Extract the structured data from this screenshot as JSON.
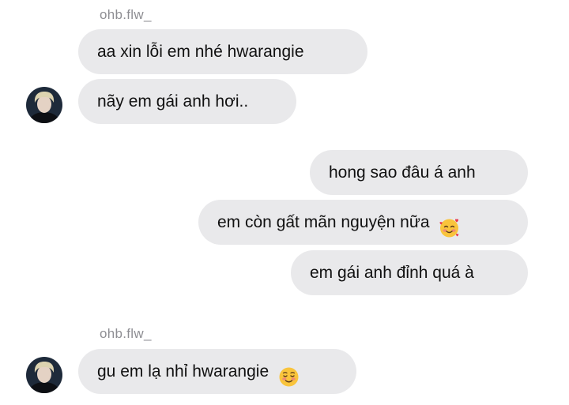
{
  "thread": {
    "group1": {
      "sender": "ohb.flw_",
      "messages": [
        "aa xin lỗi em nhé hwarangie",
        "nãy em gái anh hơi.."
      ]
    },
    "group2": {
      "messages": [
        "hong sao đâu á anh",
        "em còn gất mãn nguyện nữa",
        "em gái anh đỉnh quá à"
      ],
      "emoji_2": "smiling-face-with-hearts-icon"
    },
    "group3": {
      "sender": "ohb.flw_",
      "messages": [
        "gu em lạ nhỉ hwarangie"
      ],
      "emoji_1": "smiling-face-icon"
    }
  },
  "colors": {
    "bubble": "#e9e9eb",
    "sender_text": "#8e8e93",
    "text": "#111111",
    "emoji_face": "#f9c43c"
  }
}
